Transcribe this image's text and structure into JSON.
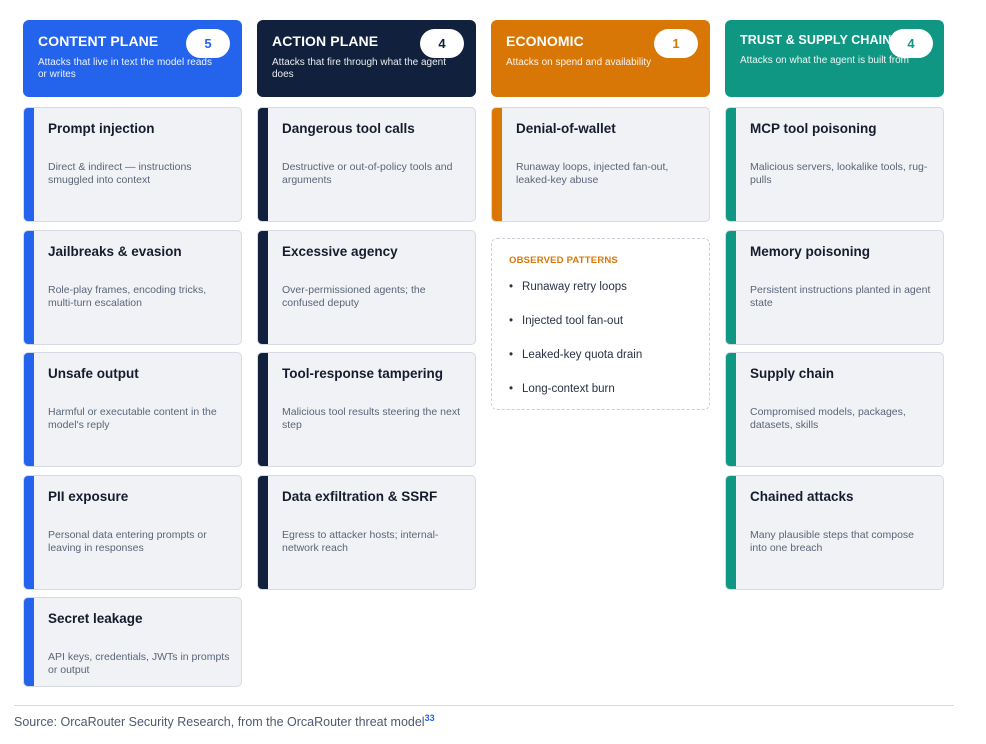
{
  "colors": {
    "content": "#2463eb",
    "action": "#10203d",
    "economic": "#d97706",
    "trust": "#0f9783"
  },
  "columns": [
    {
      "title": "CONTENT PLANE",
      "count": "5",
      "subtitle": "Attacks that live in text the model reads or writes",
      "cards": [
        {
          "title": "Prompt injection",
          "desc": "Direct & indirect — instructions smuggled into context"
        },
        {
          "title": "Jailbreaks & evasion",
          "desc": "Role-play frames, encoding tricks, multi-turn escalation"
        },
        {
          "title": "Unsafe output",
          "desc": "Harmful or executable content in the model's reply"
        },
        {
          "title": "PII exposure",
          "desc": "Personal data entering prompts or leaving in responses"
        },
        {
          "title": "Secret leakage",
          "desc": "API keys, credentials, JWTs in prompts or output"
        }
      ]
    },
    {
      "title": "ACTION PLANE",
      "count": "4",
      "subtitle": "Attacks that fire through what the agent does",
      "cards": [
        {
          "title": "Dangerous tool calls",
          "desc": "Destructive or out-of-policy tools and arguments"
        },
        {
          "title": "Excessive agency",
          "desc": "Over-permissioned agents; the confused deputy"
        },
        {
          "title": "Tool-response tampering",
          "desc": "Malicious tool results steering the next step"
        },
        {
          "title": "Data exfiltration & SSRF",
          "desc": "Egress to attacker hosts; internal-network reach"
        }
      ]
    },
    {
      "title": "ECONOMIC",
      "count": "1",
      "subtitle": "Attacks on spend and availability",
      "cards": [
        {
          "title": "Denial-of-wallet",
          "desc": "Runaway loops, injected fan-out, leaked-key abuse"
        }
      ],
      "patterns": {
        "title": "OBSERVED PATTERNS",
        "items": [
          "Runaway retry loops",
          "Injected tool fan-out",
          "Leaked-key quota drain",
          "Long-context burn"
        ]
      }
    },
    {
      "title": "TRUST & SUPPLY CHAIN",
      "count": "4",
      "subtitle": "Attacks on what the agent is built from",
      "cards": [
        {
          "title": "MCP tool poisoning",
          "desc": "Malicious servers, lookalike tools, rug-pulls"
        },
        {
          "title": "Memory poisoning",
          "desc": "Persistent instructions planted in agent state"
        },
        {
          "title": "Supply chain",
          "desc": "Compromised models, packages, datasets, skills"
        },
        {
          "title": "Chained attacks",
          "desc": "Many plausible steps that compose into one breach"
        }
      ]
    }
  ],
  "footer": {
    "source": "Source: OrcaRouter Security Research, from the OrcaRouter threat model",
    "ref": "33"
  }
}
